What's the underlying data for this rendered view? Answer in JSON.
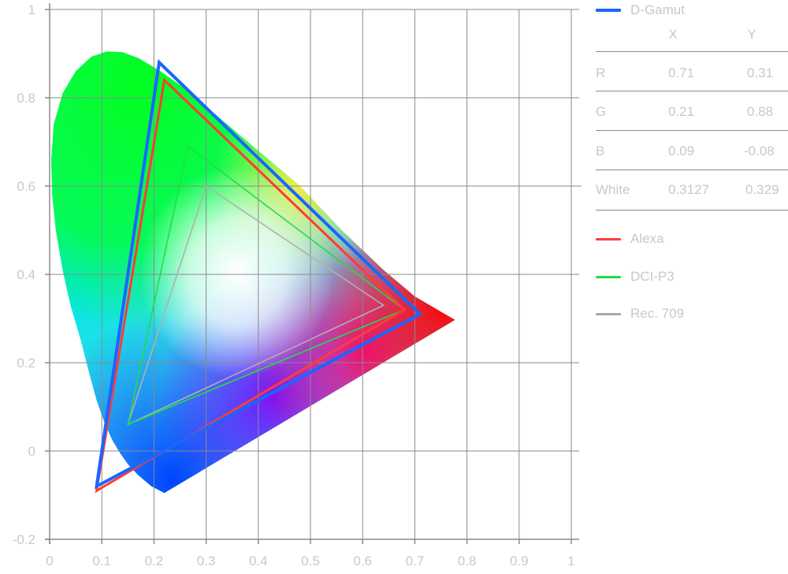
{
  "chart_data": {
    "type": "chromaticity-diagram",
    "xlim": [
      0,
      1
    ],
    "ylim": [
      -0.2,
      1
    ],
    "x_ticks": [
      {
        "v": 0,
        "label": "0"
      },
      {
        "v": 0.1,
        "label": "0.1"
      },
      {
        "v": 0.2,
        "label": "0.2"
      },
      {
        "v": 0.3,
        "label": "0.3"
      },
      {
        "v": 0.4,
        "label": "0.4"
      },
      {
        "v": 0.5,
        "label": "0.5"
      },
      {
        "v": 0.6,
        "label": "0.6"
      },
      {
        "v": 0.7,
        "label": "0.7"
      },
      {
        "v": 0.8,
        "label": "0.8"
      },
      {
        "v": 0.9,
        "label": "0.9"
      },
      {
        "v": 1,
        "label": "1"
      }
    ],
    "y_ticks": [
      {
        "v": 1,
        "label": "1"
      },
      {
        "v": 0.8,
        "label": "0.8"
      },
      {
        "v": 0.6,
        "label": "0.6"
      },
      {
        "v": 0.4,
        "label": "0.4"
      },
      {
        "v": 0.2,
        "label": "0.2"
      },
      {
        "v": 0,
        "label": "0"
      },
      {
        "v": -0.2,
        "label": "-0.2"
      }
    ],
    "grid": true,
    "spectral_locus": [
      [
        0.22,
        -0.095
      ],
      [
        0.195,
        -0.08
      ],
      [
        0.17,
        -0.055
      ],
      [
        0.15,
        -0.03
      ],
      [
        0.135,
        -0.005
      ],
      [
        0.12,
        0.025
      ],
      [
        0.105,
        0.065
      ],
      [
        0.09,
        0.115
      ],
      [
        0.075,
        0.18
      ],
      [
        0.06,
        0.25
      ],
      [
        0.04,
        0.33
      ],
      [
        0.025,
        0.41
      ],
      [
        0.012,
        0.5
      ],
      [
        0.005,
        0.58
      ],
      [
        0.003,
        0.66
      ],
      [
        0.008,
        0.74
      ],
      [
        0.025,
        0.81
      ],
      [
        0.05,
        0.86
      ],
      [
        0.08,
        0.893
      ],
      [
        0.11,
        0.905
      ],
      [
        0.14,
        0.903
      ],
      [
        0.17,
        0.89
      ],
      [
        0.21,
        0.862
      ],
      [
        0.26,
        0.82
      ],
      [
        0.32,
        0.76
      ],
      [
        0.4,
        0.68
      ],
      [
        0.48,
        0.6
      ],
      [
        0.56,
        0.5
      ],
      [
        0.64,
        0.41
      ],
      [
        0.7,
        0.35
      ],
      [
        0.777,
        0.297
      ]
    ],
    "line_of_purples": [
      [
        0.777,
        0.297
      ],
      [
        0.22,
        -0.095
      ]
    ],
    "series": [
      {
        "name": "D-Gamut",
        "color": "#1a66ff",
        "stroke_weight": "thick",
        "points": [
          [
            0.71,
            0.31
          ],
          [
            0.21,
            0.88
          ],
          [
            0.09,
            -0.08
          ]
        ]
      },
      {
        "name": "Alexa",
        "color": "#ff3b3b",
        "stroke_weight": "medium",
        "points": [
          [
            0.68,
            0.32
          ],
          [
            0.22,
            0.84
          ],
          [
            0.09,
            -0.09
          ]
        ]
      },
      {
        "name": "DCI-P3",
        "color": "#22dd44",
        "stroke_weight": "thin",
        "points": [
          [
            0.68,
            0.32
          ],
          [
            0.265,
            0.69
          ],
          [
            0.15,
            0.06
          ]
        ]
      },
      {
        "name": "Rec. 709",
        "color": "#b0b0b0",
        "stroke_weight": "thin",
        "points": [
          [
            0.64,
            0.33
          ],
          [
            0.3,
            0.6
          ],
          [
            0.15,
            0.06
          ]
        ]
      }
    ],
    "d_gamut_table": {
      "header": [
        "",
        "X",
        "Y"
      ],
      "rows": [
        [
          "R",
          "0.71",
          "0.31"
        ],
        [
          "G",
          "0.21",
          "0.88"
        ],
        [
          "B",
          "0.09",
          "-0.08"
        ],
        [
          "White",
          "0.3127",
          "0.329"
        ]
      ]
    }
  }
}
